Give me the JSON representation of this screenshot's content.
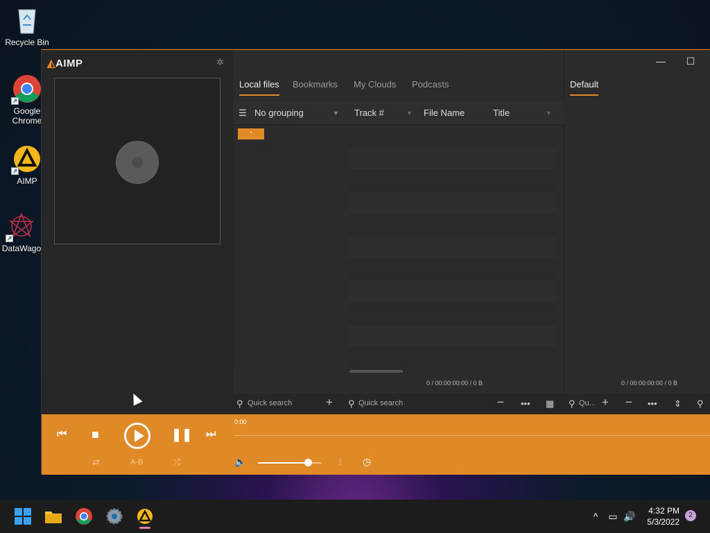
{
  "desktop": {
    "icons": [
      {
        "label": "Recycle Bin"
      },
      {
        "label": "Google Chrome"
      },
      {
        "label": "AIMP"
      },
      {
        "label": "DataWago"
      }
    ]
  },
  "app": {
    "logo": "AIMP",
    "tabs": [
      {
        "label": "Local files",
        "active": true
      },
      {
        "label": "Bookmarks",
        "active": false
      },
      {
        "label": "My Clouds",
        "active": false
      },
      {
        "label": "Podcasts",
        "active": false
      }
    ],
    "playlist_tab": "Default",
    "grouping_label": "No grouping",
    "columns": [
      "Track #",
      "File Name",
      "Title"
    ],
    "group_item": "*",
    "status_left": "0 / 00:00:00:00 / 0 B",
    "status_right": "0 / 00:00:00:00 / 0 B",
    "search_left_placeholder": "Quick search",
    "search_mid_placeholder": "Quick search",
    "search_right_placeholder": "Qu...",
    "time": "0:00",
    "ab_label": "A-B",
    "volume_level": 0.78,
    "accent_color": "#e08a27"
  },
  "taskbar": {
    "time": "4:32 PM",
    "date": "5/3/2022",
    "notifications": "2"
  }
}
